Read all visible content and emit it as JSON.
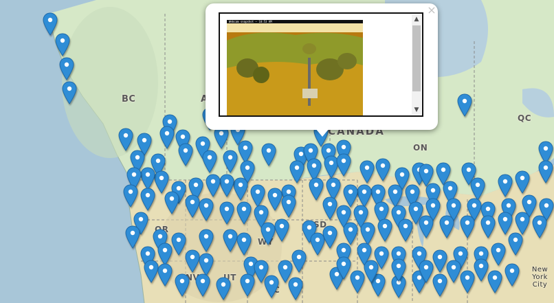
{
  "map": {
    "region_labels": [
      {
        "id": "bc",
        "text": "BC"
      },
      {
        "id": "ab",
        "text": "AB"
      },
      {
        "id": "canada",
        "text": "CANADA"
      },
      {
        "id": "on",
        "text": "ON"
      },
      {
        "id": "qc",
        "text": "QC"
      },
      {
        "id": "or",
        "text": "OR"
      },
      {
        "id": "sd",
        "text": "SD"
      },
      {
        "id": "wy",
        "text": "WY"
      },
      {
        "id": "nv",
        "text": "NV"
      },
      {
        "id": "ut",
        "text": "UT"
      },
      {
        "id": "co",
        "text": "C"
      }
    ],
    "city_labels": [
      {
        "id": "new-york",
        "line1": "New York",
        "line2": "City"
      }
    ],
    "colors": {
      "water": "#a8c6d8",
      "land_canada": "#d3e6c7",
      "land_us": "#e6ddb8",
      "pin": "#2f8dd6",
      "pin_border": "#1f6aa8"
    },
    "marker_icon": "map-marker-icon"
  },
  "popup": {
    "close_symbol": "×",
    "webcam_caption": "Webcam snapshot — 10:53 AM",
    "scroll_up": "▲",
    "scroll_down": "▼"
  }
}
